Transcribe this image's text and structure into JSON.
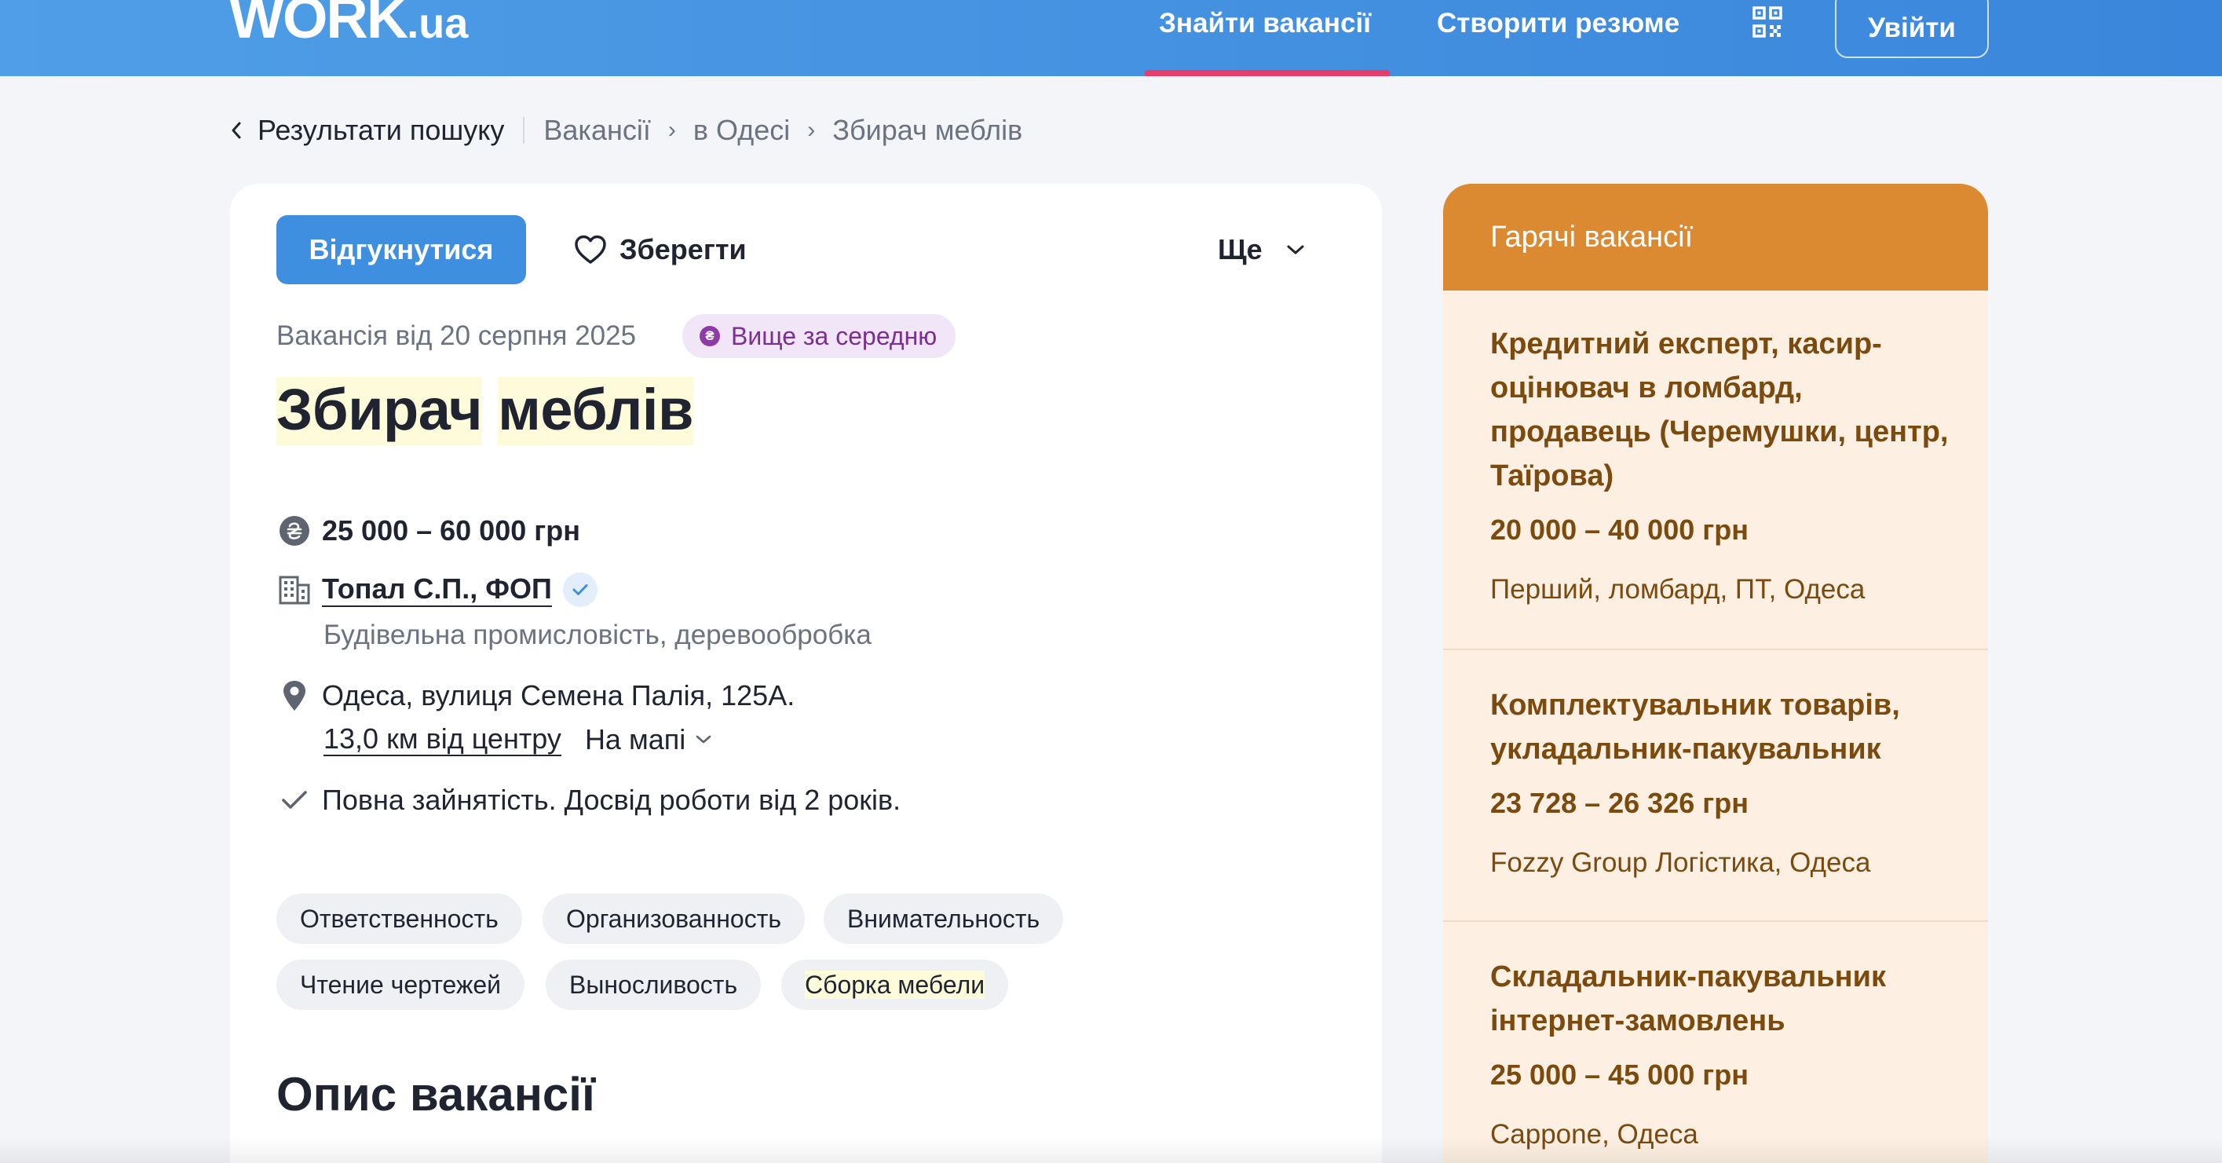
{
  "header": {
    "logo_main": "WORK",
    "logo_suffix": ".ua",
    "nav_find_jobs": "Знайти вакансії",
    "nav_create_resume": "Створити резюме",
    "login": "Увійти",
    "qr_icon": "qr-code-icon",
    "colors": {
      "bar": "#3a86dc",
      "active_tab_underline": "#e63e6b"
    }
  },
  "breadcrumb": {
    "back": "Результати пошуку",
    "items": [
      "Вакансії",
      "в Одесі",
      "Збирач меблів"
    ]
  },
  "vacancy": {
    "apply_label": "Відгукнутися",
    "save_label": "Зберегти",
    "more_label": "Ще",
    "date": "Вакансія від 20 серпня 2025",
    "badge": "Вище за середню",
    "badge_coin": "₴",
    "title_words": [
      "Збирач",
      "меблів"
    ],
    "salary": "25 000 – 60 000 грн",
    "company": "Топал С.П., ФОП",
    "industry": "Будівельна промисловість, деревообробка",
    "address": "Одеса, вулиця Семена Палія, 125А.",
    "distance": "13,0 км від центру",
    "map_label": "На мапі",
    "employment": "Повна зайнятість. Досвід роботи від 2 років.",
    "tags": [
      "Ответственность",
      "Организованность",
      "Внимательность",
      "Чтение чертежей",
      "Выносливость",
      "Сборка мебели"
    ],
    "description_title": "Опис вакансії",
    "colors": {
      "apply_button": "#3f8fe0",
      "highlight": "#fdfbd9",
      "badge_bg": "#f1e6f7"
    }
  },
  "hot_jobs": {
    "title": "Гарячі вакансії",
    "items": [
      {
        "title": "Кредитний експерт, касир-оцінювач в ломбард, продавець (Черемушки, центр, Таїрова)",
        "salary": "20 000 – 40 000 грн",
        "company": "Перший, ломбард, ПТ, Одеса"
      },
      {
        "title": "Комплектувальник товарів, укладальник-пакувальник",
        "salary": "23 728 – 26 326 грн",
        "company": "Fozzy Group Логістика, Одеса"
      },
      {
        "title": "Складальник-пакувальник інтернет-замовлень",
        "salary": "25 000 – 45 000 грн",
        "company": "Cappone, Одеса"
      }
    ],
    "colors": {
      "header": "#db8a32",
      "body": "#fdf0e2",
      "text": "#7a4a0f"
    }
  }
}
